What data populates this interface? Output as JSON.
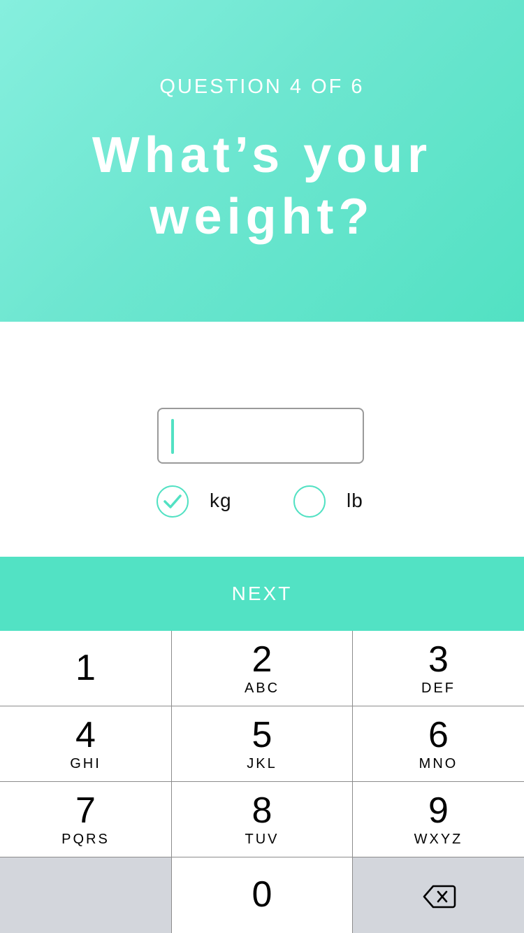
{
  "header": {
    "step": "QUESTION 4 OF 6",
    "title_line1": "What’s your",
    "title_line2": "weight?"
  },
  "weight_input": {
    "value": "",
    "placeholder": ""
  },
  "units": [
    {
      "label": "kg",
      "selected": true
    },
    {
      "label": "lb",
      "selected": false
    }
  ],
  "next_label": "NEXT",
  "keypad": {
    "keys": [
      {
        "num": "1",
        "letters": ""
      },
      {
        "num": "2",
        "letters": "ABC"
      },
      {
        "num": "3",
        "letters": "DEF"
      },
      {
        "num": "4",
        "letters": "GHI"
      },
      {
        "num": "5",
        "letters": "JKL"
      },
      {
        "num": "6",
        "letters": "MNO"
      },
      {
        "num": "7",
        "letters": "PQRS"
      },
      {
        "num": "8",
        "letters": "TUV"
      },
      {
        "num": "9",
        "letters": "WXYZ"
      },
      {
        "num": "0",
        "letters": ""
      }
    ],
    "delete_icon": "backspace-icon"
  },
  "colors": {
    "accent": "#52e1c3",
    "header_gradient_start": "#86efde",
    "header_gradient_end": "#52e1c3",
    "keypad_gray": "#d3d6dc"
  }
}
